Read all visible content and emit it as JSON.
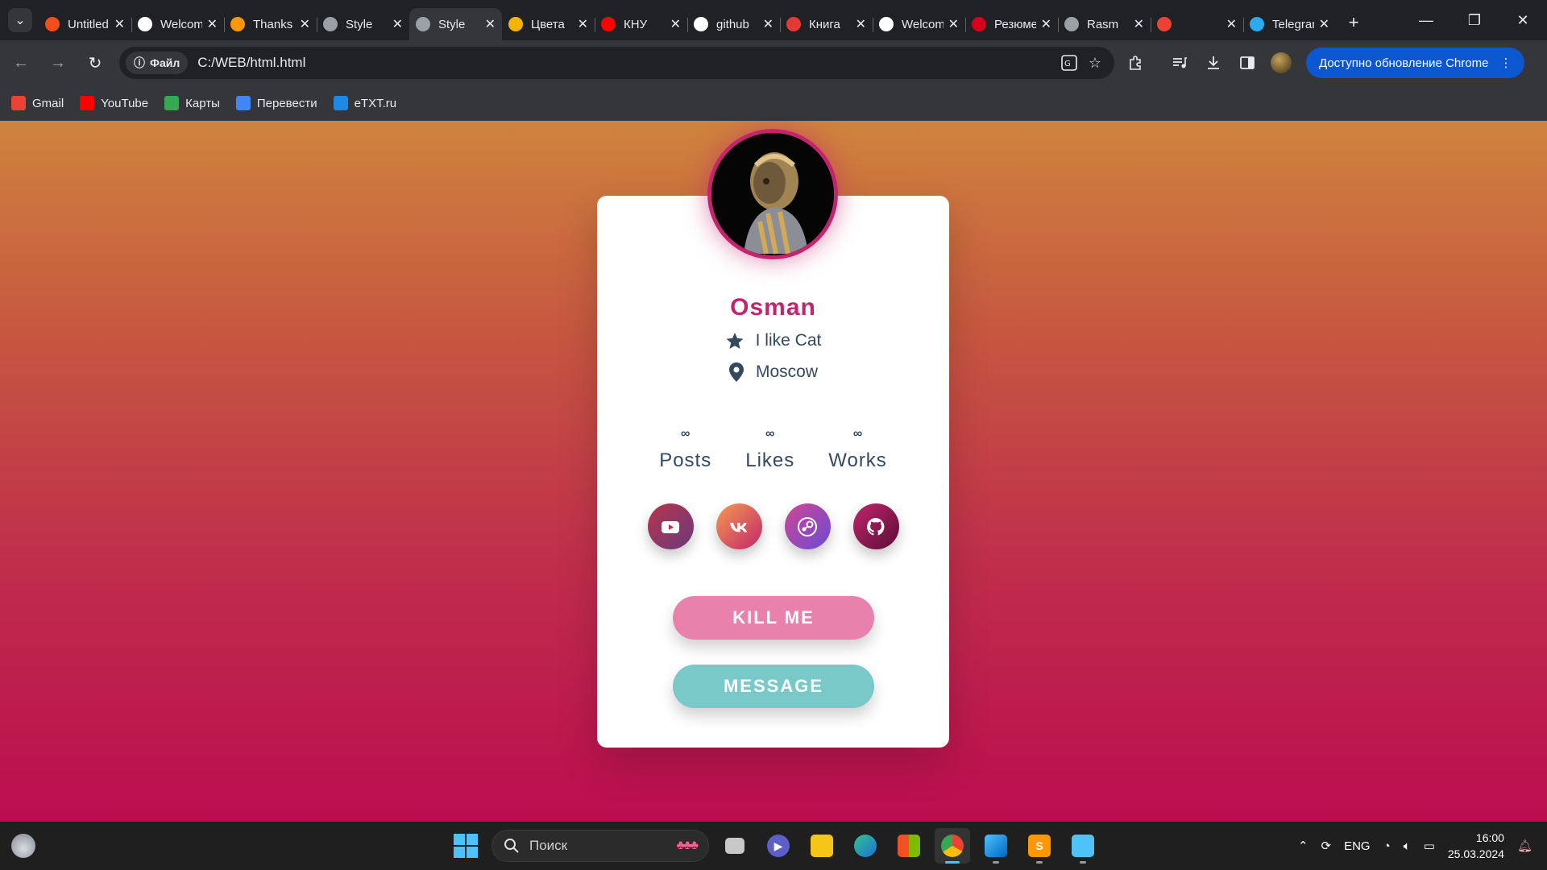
{
  "browser": {
    "tabs": [
      {
        "title": "Untitled",
        "favicon": "figma-icon",
        "color": "#f24e1e",
        "active": false
      },
      {
        "title": "Welcome",
        "favicon": "github-icon",
        "color": "#ffffff",
        "active": false
      },
      {
        "title": "Thanks",
        "favicon": "sublime-icon",
        "color": "#ff9800",
        "active": false
      },
      {
        "title": "Style",
        "favicon": "globe-icon",
        "color": "#9aa0a6",
        "active": false
      },
      {
        "title": "Style",
        "favicon": "globe-icon",
        "color": "#9aa0a6",
        "active": true
      },
      {
        "title": "Цвета",
        "favicon": "w-icon",
        "color": "#f5b400",
        "active": false
      },
      {
        "title": "КНУ",
        "favicon": "youtube-icon",
        "color": "#ff0000",
        "active": false
      },
      {
        "title": "github",
        "favicon": "google-icon",
        "color": "#ffffff",
        "active": false
      },
      {
        "title": "Книга",
        "favicon": "star-icon",
        "color": "#e53935",
        "active": false
      },
      {
        "title": "Welcome",
        "favicon": "github-icon",
        "color": "#ffffff",
        "active": false
      },
      {
        "title": "Резюме",
        "favicon": "hh-icon",
        "color": "#d6001c",
        "active": false
      },
      {
        "title": "Rasm",
        "favicon": "globe-icon",
        "color": "#9aa0a6",
        "active": false
      },
      {
        "title": "",
        "favicon": "gmail-icon",
        "color": "#ea4335",
        "active": false
      },
      {
        "title": "Telegram",
        "favicon": "telegram-icon",
        "color": "#2aabee",
        "active": false
      }
    ],
    "site_chip": "Файл",
    "url": "C:/WEB/html.html",
    "update_label": "Доступно обновление Chrome",
    "bookmarks": [
      {
        "label": "Gmail",
        "icon": "gmail-icon",
        "color": "#ea4335"
      },
      {
        "label": "YouTube",
        "icon": "youtube-icon",
        "color": "#ff0000"
      },
      {
        "label": "Карты",
        "icon": "maps-icon",
        "color": "#34a853"
      },
      {
        "label": "Перевести",
        "icon": "translate-icon",
        "color": "#4285f4"
      },
      {
        "label": "eTXT.ru",
        "icon": "etxt-icon",
        "color": "#1e88e5"
      }
    ]
  },
  "profile": {
    "name": "Osman",
    "hobby": "I like Cat",
    "city": "Moscow",
    "stats": [
      {
        "value": "∞",
        "label": "Posts"
      },
      {
        "value": "∞",
        "label": "Likes"
      },
      {
        "value": "∞",
        "label": "Works"
      }
    ],
    "socials": [
      {
        "name": "youtube",
        "gradient": [
          "#b7344d",
          "#6a3b7a"
        ]
      },
      {
        "name": "vk",
        "gradient": [
          "#f59b4f",
          "#c2256d"
        ]
      },
      {
        "name": "steam",
        "gradient": [
          "#d0478f",
          "#6a4bd8"
        ]
      },
      {
        "name": "github",
        "gradient": [
          "#c2256d",
          "#5a0d36"
        ]
      }
    ],
    "buttons": {
      "kill": "KILL ME",
      "message": "MESSAGE"
    },
    "colors": {
      "accent": "#c2256d",
      "text": "#34495e",
      "kill": "#e882ac",
      "message": "#78c9c8"
    }
  },
  "taskbar": {
    "search_placeholder": "Поиск",
    "language": "ENG",
    "time": "16:00",
    "date": "25.03.2024"
  }
}
